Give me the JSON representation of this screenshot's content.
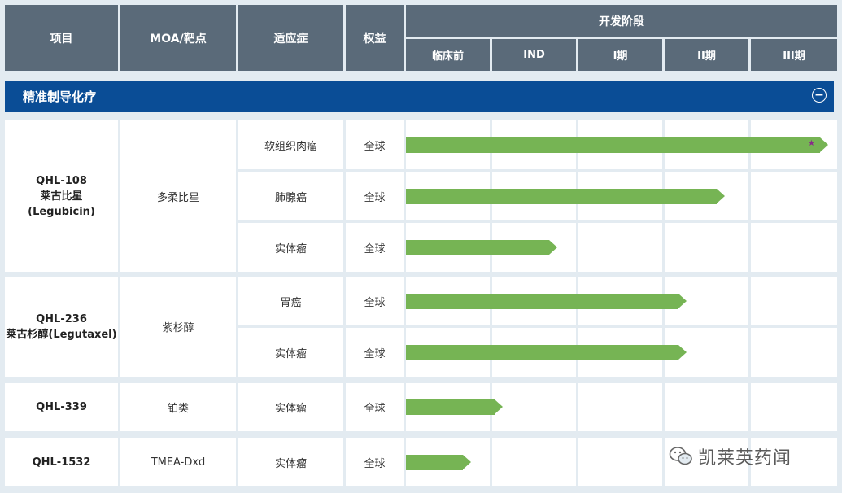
{
  "header": {
    "project": "项目",
    "moa": "MOA/靶点",
    "indication": "适应症",
    "rights": "权益",
    "dev_stage": "开发阶段",
    "phases": [
      "临床前",
      "IND",
      "I期",
      "II期",
      "III期"
    ]
  },
  "section": {
    "title": "精准制导化疗",
    "collapse_symbol": "−"
  },
  "groups": [
    {
      "project_lines": [
        "QHL-108",
        "莱古比星",
        "(Legubicin)"
      ],
      "moa": "多柔比星",
      "rows": [
        {
          "indication": "软组织肉瘤",
          "rights": "全球",
          "progress": 0.98,
          "star": "★"
        },
        {
          "indication": "肺腺癌",
          "rights": "全球",
          "progress": 0.74
        },
        {
          "indication": "实体瘤",
          "rights": "全球",
          "progress": 0.35
        }
      ]
    },
    {
      "project_lines": [
        "QHL-236",
        "莱古杉醇(Legutaxel)"
      ],
      "moa": "紫杉醇",
      "rows": [
        {
          "indication": "胃癌",
          "rights": "全球",
          "progress": 0.65
        },
        {
          "indication": "实体瘤",
          "rights": "全球",
          "progress": 0.65
        }
      ]
    },
    {
      "project_lines": [
        "QHL-339"
      ],
      "moa": "铂类",
      "rows": [
        {
          "indication": "实体瘤",
          "rights": "全球",
          "progress": 0.225
        }
      ]
    },
    {
      "project_lines": [
        "QHL-1532"
      ],
      "moa": "TMEA-Dxd",
      "rows": [
        {
          "indication": "实体瘤",
          "rights": "全球",
          "progress": 0.15
        }
      ]
    }
  ],
  "watermark": {
    "text": "凯莱英药闻"
  },
  "colors": {
    "header": "#5a6a79",
    "band": "#0a4d96",
    "bar": "#76b454",
    "star": "#8a2a8a"
  }
}
